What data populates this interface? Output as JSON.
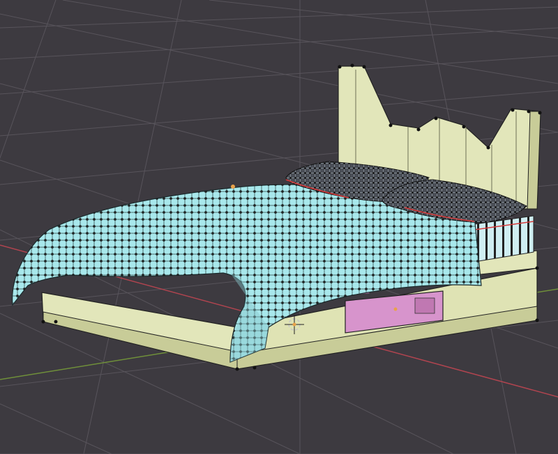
{
  "viewport": {
    "background_color": "#3d3a40",
    "grid_color": "#58545b",
    "x_axis_color": "#b0444f",
    "y_axis_color": "#6f8f3a"
  },
  "scene": {
    "object": "bed",
    "mode": "edit-mode-vertex-display",
    "materials": {
      "frame": "#e2e6ba",
      "frame_shade": "#c8cc98",
      "blanket": "#a8e8ec",
      "blanket_shade": "#88c8cc",
      "pillow": "#4a4e56",
      "mattress": "#cfeef2",
      "drawer": "#d794cc",
      "vertex": "#111111",
      "seam": "#d63a3a",
      "origin": "#e8a24a"
    }
  }
}
